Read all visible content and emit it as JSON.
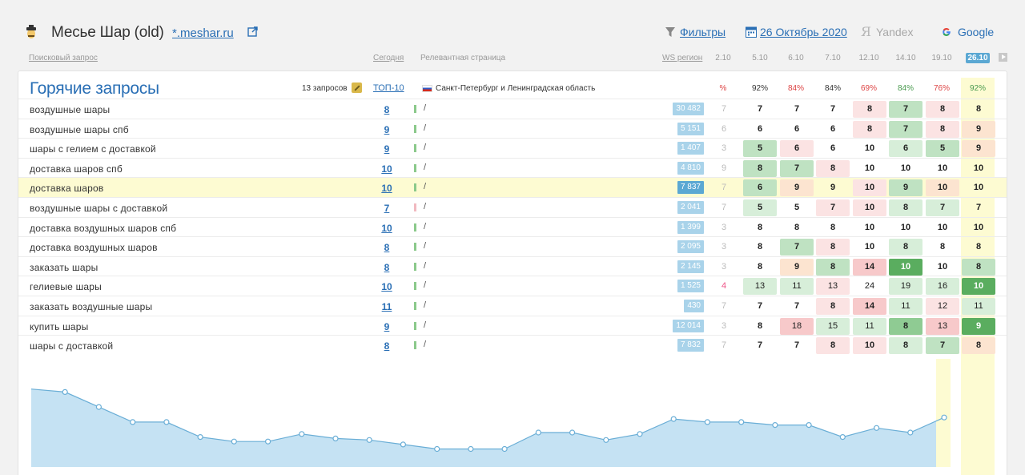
{
  "project": {
    "title": "Месье Шар (old)",
    "domain": "*.meshar.ru",
    "filters_label": "Фильтры",
    "date_label": "26 Октябрь 2020",
    "yandex_label": "Yandex",
    "google_label": "Google"
  },
  "columns": {
    "query": "Поисковый запрос",
    "today": "Сегодня",
    "relevant_page": "Релевантная страница",
    "ws_region": "WS регион",
    "dates": [
      "2.10",
      "5.10",
      "6.10",
      "7.10",
      "12.10",
      "14.10",
      "19.10",
      "26.10"
    ]
  },
  "section": {
    "title": "Горячие запросы",
    "query_count": "13 запросов",
    "top_label": "ТОП-10",
    "region": "Санкт-Петербург и Ленинградская область",
    "percents": [
      "%",
      "92%",
      "84%",
      "84%",
      "69%",
      "84%",
      "76%",
      "92%"
    ]
  },
  "rows": [
    {
      "keyword": "воздушные шары",
      "today": "8",
      "page": "/",
      "ws": "30 482",
      "positions": [
        "7",
        "7",
        "7",
        "7",
        "8",
        "7",
        "8",
        "8"
      ]
    },
    {
      "keyword": "воздушные шары спб",
      "today": "9",
      "page": "/",
      "ws": "5 151",
      "positions": [
        "6",
        "6",
        "6",
        "6",
        "8",
        "7",
        "8",
        "9"
      ]
    },
    {
      "keyword": "шары с гелием с доставкой",
      "today": "9",
      "page": "/",
      "ws": "1 407",
      "positions": [
        "3",
        "5",
        "6",
        "6",
        "10",
        "6",
        "5",
        "9"
      ]
    },
    {
      "keyword": "доставка шаров спб",
      "today": "10",
      "page": "/",
      "ws": "4 810",
      "positions": [
        "9",
        "8",
        "7",
        "8",
        "10",
        "10",
        "10",
        "10"
      ]
    },
    {
      "keyword": "доставка шаров",
      "today": "10",
      "page": "/",
      "ws": "7 837",
      "positions": [
        "7",
        "6",
        "9",
        "9",
        "10",
        "9",
        "10",
        "10"
      ]
    },
    {
      "keyword": "воздушные шары с доставкой",
      "today": "7",
      "page": "/",
      "ws": "2 041",
      "positions": [
        "7",
        "5",
        "5",
        "7",
        "10",
        "8",
        "7",
        "7"
      ]
    },
    {
      "keyword": "доставка воздушных шаров спб",
      "today": "10",
      "page": "/",
      "ws": "1 399",
      "positions": [
        "3",
        "8",
        "8",
        "8",
        "10",
        "10",
        "10",
        "10"
      ]
    },
    {
      "keyword": "доставка воздушных шаров",
      "today": "8",
      "page": "/",
      "ws": "2 095",
      "positions": [
        "3",
        "8",
        "7",
        "8",
        "10",
        "8",
        "8",
        "8"
      ]
    },
    {
      "keyword": "заказать шары",
      "today": "8",
      "page": "/",
      "ws": "2 145",
      "positions": [
        "3",
        "8",
        "9",
        "8",
        "14",
        "10",
        "10",
        "8"
      ]
    },
    {
      "keyword": "гелиевые шары",
      "today": "10",
      "page": "/",
      "ws": "1 525",
      "positions": [
        "4",
        "13",
        "11",
        "13",
        "24",
        "19",
        "16",
        "10"
      ]
    },
    {
      "keyword": "заказать воздушные шары",
      "today": "11",
      "page": "/",
      "ws": "430",
      "positions": [
        "7",
        "7",
        "7",
        "8",
        "14",
        "11",
        "12",
        "11"
      ]
    },
    {
      "keyword": "купить шары",
      "today": "9",
      "page": "/",
      "ws": "12 014",
      "positions": [
        "3",
        "8",
        "18",
        "15",
        "11",
        "8",
        "13",
        "9"
      ]
    },
    {
      "keyword": "шары с доставкой",
      "today": "8",
      "page": "/",
      "ws": "7 832",
      "positions": [
        "7",
        "7",
        "7",
        "8",
        "10",
        "8",
        "7",
        "8"
      ]
    }
  ],
  "colors": {
    "accent": "#2a6fb5",
    "chart_fill": "#c5e2f3",
    "chart_line": "#6aaed6",
    "highlight": "#fdfbd2"
  },
  "chart_data": {
    "type": "area",
    "values": [
      82,
      80,
      70,
      60,
      60,
      50,
      47,
      47,
      52,
      49,
      48,
      45,
      42,
      42,
      42,
      53,
      53,
      48,
      52,
      62,
      60,
      60,
      58,
      58,
      50,
      56,
      53,
      63
    ],
    "ylim": [
      30,
      100
    ]
  }
}
